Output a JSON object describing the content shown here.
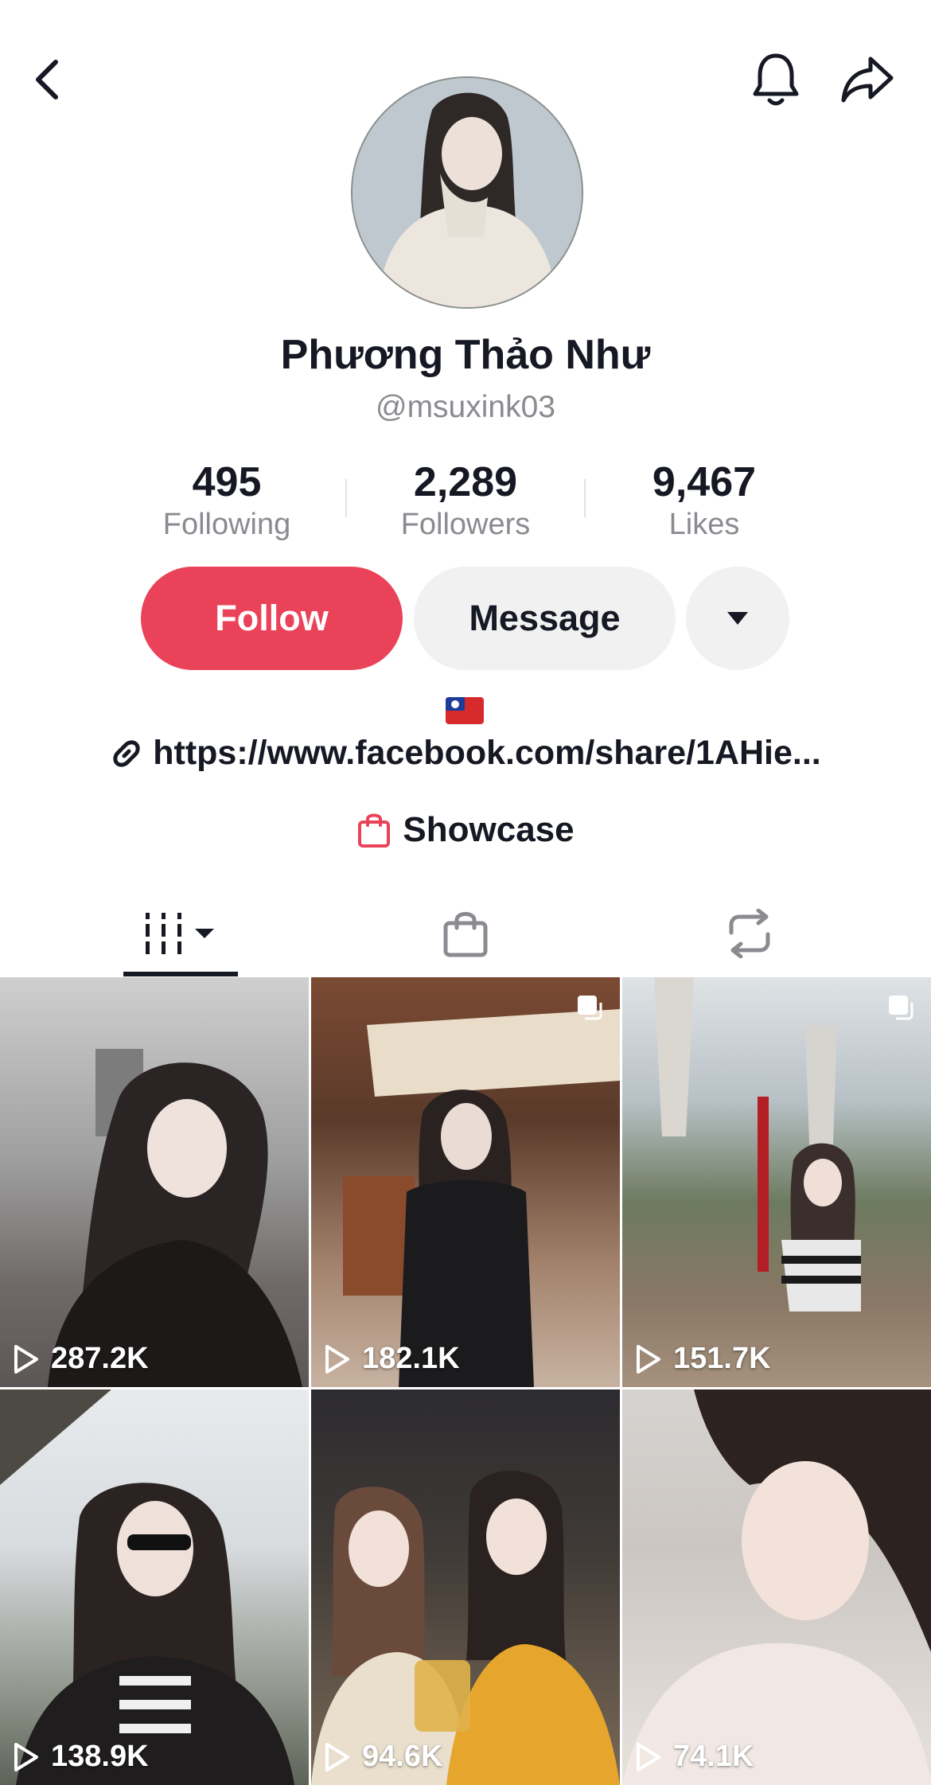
{
  "header": {
    "back": "back-icon",
    "bell": "bell-icon",
    "share": "share-icon"
  },
  "profile": {
    "name": "Phương Thảo Như",
    "handle": "@msuxink03",
    "stats": [
      {
        "value": "495",
        "label": "Following"
      },
      {
        "value": "2,289",
        "label": "Followers"
      },
      {
        "value": "9,467",
        "label": "Likes"
      }
    ],
    "bio_flag": "taiwan-flag",
    "link": "https://www.facebook.com/share/1AHie...",
    "showcase": "Showcase"
  },
  "actions": {
    "follow": "Follow",
    "message": "Message"
  },
  "colors": {
    "accent": "#ea4359",
    "secondary_bg": "#f1f1f2",
    "muted_text": "#8a8b91"
  },
  "tabs": [
    "videos-tab",
    "shop-tab",
    "reposts-tab"
  ],
  "videos": [
    {
      "views": "287.2K"
    },
    {
      "views": "182.1K"
    },
    {
      "views": "151.7K"
    },
    {
      "views": "138.9K"
    },
    {
      "views": "94.6K"
    },
    {
      "views": "74.1K"
    }
  ]
}
